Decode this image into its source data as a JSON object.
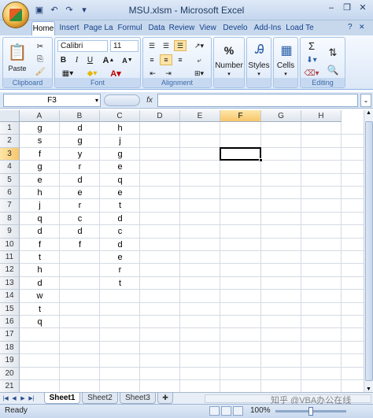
{
  "window": {
    "title": "MSU.xlsm - Microsoft Excel"
  },
  "qat": {
    "save_icon": "save-icon",
    "undo_icon": "undo-icon",
    "redo_icon": "redo-icon",
    "customize_icon": "customize-icon"
  },
  "tabs": [
    "Home",
    "Insert",
    "Page La",
    "Formul",
    "Data",
    "Review",
    "View",
    "Develo",
    "Add-Ins",
    "Load Te"
  ],
  "ribbon": {
    "clipboard": {
      "label": "Clipboard",
      "paste": "Paste"
    },
    "font": {
      "label": "Font",
      "name": "Calibri",
      "size": "11",
      "bold": "B",
      "italic": "I",
      "underline": "U"
    },
    "alignment": {
      "label": "Alignment"
    },
    "number": {
      "label": "Number",
      "percent": "%"
    },
    "styles": {
      "label": "Styles"
    },
    "cells": {
      "label": "Cells"
    },
    "editing": {
      "label": "Editing",
      "sum": "Σ"
    }
  },
  "formula_bar": {
    "name_box": "F3",
    "fx": "fx",
    "content": ""
  },
  "columns": [
    "A",
    "B",
    "C",
    "D",
    "E",
    "F",
    "G",
    "H"
  ],
  "selected_cell": {
    "col": "F",
    "row": 3
  },
  "rows": [
    [
      "g",
      "d",
      "h"
    ],
    [
      "s",
      "g",
      "j"
    ],
    [
      "f",
      "y",
      "g"
    ],
    [
      "g",
      "r",
      "e"
    ],
    [
      "e",
      "d",
      "q"
    ],
    [
      "h",
      "e",
      "e"
    ],
    [
      "j",
      "r",
      "t"
    ],
    [
      "q",
      "c",
      "d"
    ],
    [
      "d",
      "d",
      "c"
    ],
    [
      "f",
      "f",
      "d"
    ],
    [
      "t",
      "",
      "e"
    ],
    [
      "h",
      "",
      "r"
    ],
    [
      "d",
      "",
      "t"
    ],
    [
      "w",
      "",
      ""
    ],
    [
      "t",
      "",
      ""
    ],
    [
      "q",
      "",
      ""
    ],
    [
      "",
      "",
      ""
    ],
    [
      "",
      "",
      ""
    ],
    [
      "",
      "",
      ""
    ],
    [
      "",
      "",
      ""
    ],
    [
      "",
      "",
      ""
    ]
  ],
  "sheets": [
    "Sheet1",
    "Sheet2",
    "Sheet3"
  ],
  "active_sheet": "Sheet1",
  "status": {
    "mode": "Ready",
    "zoom": "100%"
  },
  "watermark": "知乎 @VBA办公在线"
}
